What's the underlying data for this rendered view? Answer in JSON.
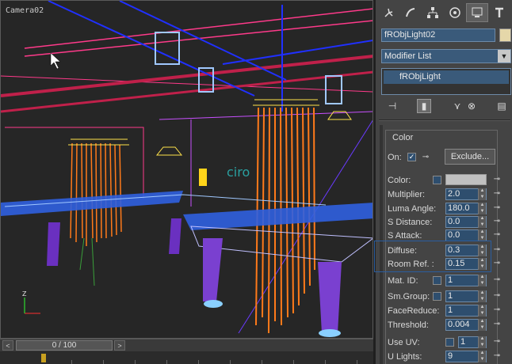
{
  "viewport": {
    "label": "Camera02",
    "scene_text": "ciro"
  },
  "timebar": {
    "frame": "0 / 100",
    "prev": "<",
    "next": ">"
  },
  "panel": {
    "tabs": [
      "create-icon",
      "modify-icon",
      "hierarchy-icon",
      "motion-icon",
      "display-icon",
      "utilities-icon"
    ],
    "object_name": "fRObjLight02",
    "object_color": "#e5d7a9",
    "modifier_list": "Modifier List",
    "stack_item": "fRObjLight",
    "rollout_title": "Color",
    "on_label": "On:",
    "on_checked": true,
    "exclude_label": "Exclude...",
    "color_label": "Color:",
    "swatch_color": "#c0c0c0",
    "params": [
      {
        "label": "Multiplier:",
        "value": "2.0"
      },
      {
        "label": "Luma Angle:",
        "value": "180.0"
      },
      {
        "label": "S Distance:",
        "value": "0.0"
      },
      {
        "label": "S Attack:",
        "value": "0.0"
      },
      {
        "label": "Diffuse:",
        "value": "0.3"
      },
      {
        "label": "Room Ref. :",
        "value": "0.15"
      }
    ],
    "params2": [
      {
        "label": "Mat. ID:",
        "value": "1",
        "check": true
      },
      {
        "label": "Sm.Group:",
        "value": "1",
        "check": true
      },
      {
        "label": "FaceReduce:",
        "value": "1",
        "check": false
      },
      {
        "label": "Threshold:",
        "value": "0.004",
        "check": false
      },
      {
        "label": "Use UV:",
        "value": "1",
        "check": true
      },
      {
        "label": "U Lights:",
        "value": "9",
        "check": false
      }
    ]
  }
}
